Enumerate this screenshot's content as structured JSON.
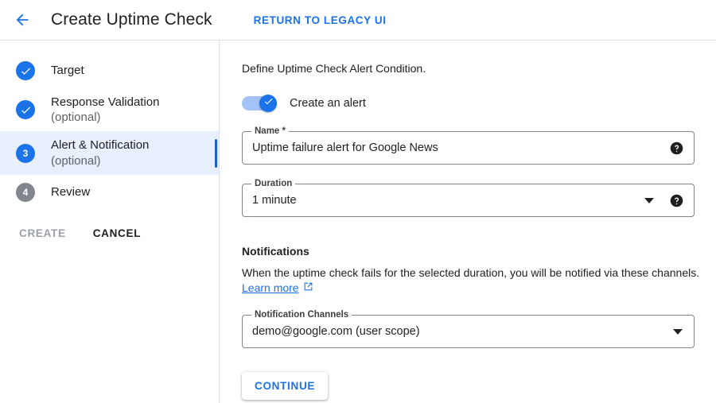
{
  "header": {
    "back_icon": "arrow-left-icon",
    "title": "Create Uptime Check",
    "legacy_link": "RETURN TO LEGACY UI"
  },
  "sidebar": {
    "steps": [
      {
        "badge": "check-icon",
        "state": "complete",
        "label": "Target",
        "sub": ""
      },
      {
        "badge": "check-icon",
        "state": "complete",
        "label": "Response Validation",
        "sub": "(optional)"
      },
      {
        "badge": "3",
        "state": "active",
        "label": "Alert & Notification",
        "sub": "(optional)"
      },
      {
        "badge": "4",
        "state": "pending",
        "label": "Review",
        "sub": ""
      }
    ],
    "actions": {
      "create_label": "CREATE",
      "cancel_label": "CANCEL"
    }
  },
  "main": {
    "intro": "Define Uptime Check Alert Condition.",
    "toggle": {
      "label": "Create an alert",
      "checked": true
    },
    "name_field": {
      "legend": "Name *",
      "value": "Uptime failure alert for Google News",
      "placeholder": "Name",
      "help_icon": "help-circle-icon"
    },
    "duration_field": {
      "legend": "Duration",
      "value": "1 minute",
      "caret_icon": "chevron-down-icon",
      "help_icon": "help-circle-icon"
    },
    "notifications": {
      "title": "Notifications",
      "description": "When the uptime check fails for the selected duration, you will be notified via these channels.",
      "learn_more": "Learn more",
      "learn_more_icon": "external-link-icon"
    },
    "channels_field": {
      "legend": "Notification Channels",
      "value": "demo@google.com (user scope)",
      "caret_icon": "chevron-down-icon"
    },
    "continue_label": "CONTINUE"
  },
  "colors": {
    "accent": "#1a73e8",
    "active_row": "#e8f0fe",
    "indicator": "#1a5fd0",
    "pending_badge": "#80868b",
    "muted_text": "#5f6368",
    "border": "#80868b",
    "divider": "#e0e0e0"
  }
}
